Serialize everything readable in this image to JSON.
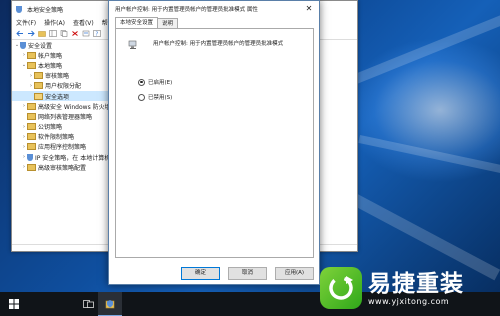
{
  "bg_window": {
    "title": "本地安全策略",
    "menu": [
      "文件(F)",
      "操作(A)",
      "查看(V)",
      "帮助(H)"
    ],
    "tree": [
      {
        "label": "安全设置",
        "level": 0,
        "expander": "⌄",
        "icon": "shield-icon"
      },
      {
        "label": "帐户策略",
        "level": 1,
        "expander": "›",
        "icon": "folder-icon"
      },
      {
        "label": "本地策略",
        "level": 1,
        "expander": "⌄",
        "icon": "folder-icon"
      },
      {
        "label": "审核策略",
        "level": 2,
        "expander": "›",
        "icon": "folder-icon"
      },
      {
        "label": "用户权限分配",
        "level": 2,
        "expander": "›",
        "icon": "folder-icon"
      },
      {
        "label": "安全选项",
        "level": 2,
        "expander": "",
        "icon": "folder-icon",
        "selected": true
      },
      {
        "label": "高级安全 Windows 防火墙",
        "level": 1,
        "expander": "›",
        "icon": "folder-icon"
      },
      {
        "label": "网络列表管理器策略",
        "level": 1,
        "expander": "",
        "icon": "folder-icon"
      },
      {
        "label": "公钥策略",
        "level": 1,
        "expander": "›",
        "icon": "folder-icon"
      },
      {
        "label": "软件限制策略",
        "level": 1,
        "expander": "›",
        "icon": "folder-icon"
      },
      {
        "label": "应用程序控制策略",
        "level": 1,
        "expander": "›",
        "icon": "folder-icon"
      },
      {
        "label": "IP 安全策略，在 本地计算机",
        "level": 1,
        "expander": "›",
        "icon": "shield-icon"
      },
      {
        "label": "高级审核策略配置",
        "level": 1,
        "expander": "›",
        "icon": "folder-icon"
      }
    ],
    "right_col_marks": [
      "",
      "",
      "",
      "",
      "",
      "",
      "",
      "",
      "",
      "",
      "",
      "",
      "",
      "",
      "",
      "",
      "",
      "",
      "",
      "",
      "",
      "",
      ""
    ]
  },
  "dialog": {
    "title": "用户帐户控制: 用于内置管理员帐户的管理员批准模式 属性",
    "close_glyph": "✕",
    "tabs": [
      "本地安全设置",
      "说明"
    ],
    "policy_text": "用户帐户控制: 用于内置管理员帐户的管理员批准模式",
    "options": [
      {
        "label": "已启用(E)",
        "selected": true
      },
      {
        "label": "已禁用(S)",
        "selected": false
      }
    ],
    "buttons": {
      "ok": "确定",
      "cancel": "取消",
      "apply": "应用(A)"
    }
  },
  "watermark": {
    "brand": "易捷重装",
    "url": "www.yjxitong.com"
  },
  "colors": {
    "accent": "#0078d7",
    "logo_green": "#3cb521"
  }
}
